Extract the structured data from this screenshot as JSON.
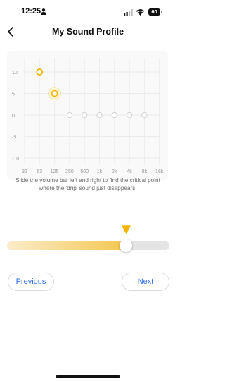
{
  "status_bar": {
    "time": "12:25",
    "battery": "60",
    "icons": [
      "person-icon",
      "signal-icon",
      "wifi-icon",
      "battery-icon"
    ]
  },
  "header": {
    "title": "My Sound Profile",
    "back_icon": "chevron-left-icon"
  },
  "colors": {
    "accent": "#f5b400",
    "link": "#2b6de0",
    "muted_text": "#6b6b6b",
    "track": "#e4e4e4"
  },
  "chart_data": {
    "type": "scatter",
    "title": "",
    "xlabel": "",
    "ylabel": "",
    "categories": [
      "32",
      "63",
      "125",
      "250",
      "500",
      "1k",
      "2k",
      "4k",
      "8k",
      "16k"
    ],
    "yticks": [
      "10",
      "5",
      "0",
      "-5",
      "-10"
    ],
    "ylim": [
      -10,
      10
    ],
    "grid": true,
    "points": [
      {
        "x": "63",
        "y": 10,
        "state": "set"
      },
      {
        "x": "125",
        "y": 5,
        "state": "active"
      },
      {
        "x": "250",
        "y": 0,
        "state": "pending"
      },
      {
        "x": "500",
        "y": 0,
        "state": "pending"
      },
      {
        "x": "1k",
        "y": 0,
        "state": "pending"
      },
      {
        "x": "2k",
        "y": 0,
        "state": "pending"
      },
      {
        "x": "4k",
        "y": 0,
        "state": "pending"
      },
      {
        "x": "8k",
        "y": 0,
        "state": "pending"
      }
    ]
  },
  "instruction": "Slide the volume bar left and right to find the critical point where the 'drip' sound just disappears.",
  "slider": {
    "value_fraction": 0.73,
    "marker_icon": "triangle-down-icon"
  },
  "buttons": {
    "previous": "Previous",
    "next": "Next"
  }
}
